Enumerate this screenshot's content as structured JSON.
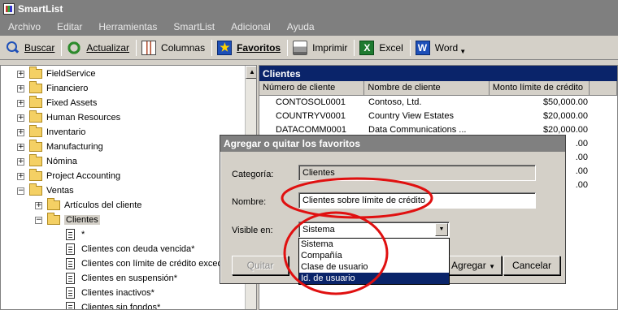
{
  "window": {
    "title": "SmartList"
  },
  "menu": [
    "Archivo",
    "Editar",
    "Herramientas",
    "SmartList",
    "Adicional",
    "Ayuda"
  ],
  "toolbar": {
    "buscar": "Buscar",
    "actualizar": "Actualizar",
    "columnas": "Columnas",
    "favoritos": "Favoritos",
    "imprimir": "Imprimir",
    "excel": "Excel",
    "word": "Word"
  },
  "tree": {
    "items": [
      "FieldService",
      "Financiero",
      "Fixed Assets",
      "Human Resources",
      "Inventario",
      "Manufacturing",
      "Nómina",
      "Project Accounting",
      "Ventas",
      "Artículos del cliente",
      "Clientes",
      "*",
      "Clientes con deuda vencida*",
      "Clientes con límite de crédito exced",
      "Clientes en suspensión*",
      "Clientes inactivos*",
      "Clientes sin fondos*"
    ]
  },
  "grid": {
    "title": "Clientes",
    "columns": [
      "Número de cliente",
      "Nombre de cliente",
      "Monto límite de crédito",
      ""
    ],
    "rows": [
      [
        "CONTOSOL0001",
        "Contoso, Ltd.",
        "$50,000.00"
      ],
      [
        "COUNTRYV0001",
        "Country View Estates",
        "$20,000.00"
      ],
      [
        "DATACOMM0001",
        "Data Communications ...",
        "$20,000.00"
      ],
      [
        "",
        "",
        ".00"
      ],
      [
        "",
        "",
        ".00"
      ],
      [
        "",
        "",
        ".00"
      ],
      [
        "",
        "",
        ".00"
      ]
    ]
  },
  "dialog": {
    "title": "Agregar o quitar los favoritos",
    "categoria_label": "Categoría:",
    "categoria_value": "Clientes",
    "nombre_label": "Nombre:",
    "nombre_value": "Clientes sobre límite de crédito",
    "visible_label": "Visible en:",
    "visible_value": "Sistema",
    "options": [
      "Sistema",
      "Compañía",
      "Clase de usuario",
      "Id. de usuario"
    ],
    "quitar": "Quitar",
    "agregar": "Agregar",
    "cancelar": "Cancelar"
  },
  "colors": {
    "annotation": "#e01010",
    "selection": "#0a246a"
  }
}
